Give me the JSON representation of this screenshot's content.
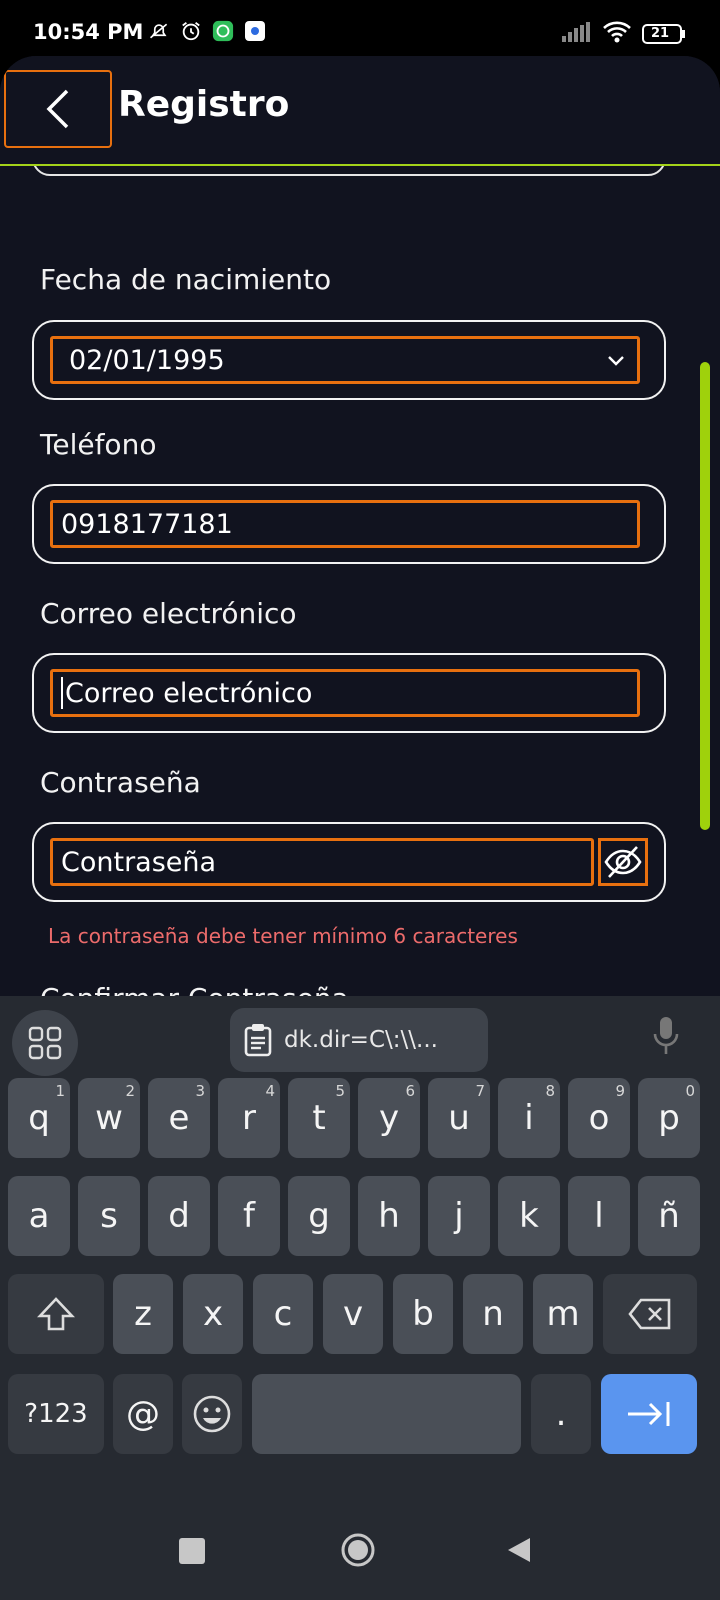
{
  "status_bar": {
    "time": "10:54 PM",
    "left_icons": [
      "mute-icon",
      "alarm-icon",
      "whatsapp-icon",
      "app-icon"
    ],
    "right_icons": [
      "signal-icon",
      "wifi-icon",
      "battery-icon"
    ],
    "battery": "21"
  },
  "header": {
    "title": "Registro"
  },
  "form": {
    "birthdate": {
      "label": "Fecha de nacimiento",
      "value": "02/01/1995"
    },
    "phone": {
      "label": "Teléfono",
      "value": "0918177181"
    },
    "email": {
      "label": "Correo electrónico",
      "placeholder": "Correo electrónico"
    },
    "password": {
      "label": "Contraseña",
      "placeholder": "Contraseña",
      "error": "La contraseña debe tener mínimo 6 caracteres"
    },
    "confirm_password": {
      "label": "Confirmar Contraseña"
    }
  },
  "keyboard": {
    "clipboard_text": "dk.dir=C\\:\\\\...",
    "row1": [
      {
        "k": "q",
        "h": "1"
      },
      {
        "k": "w",
        "h": "2"
      },
      {
        "k": "e",
        "h": "3"
      },
      {
        "k": "r",
        "h": "4"
      },
      {
        "k": "t",
        "h": "5"
      },
      {
        "k": "y",
        "h": "6"
      },
      {
        "k": "u",
        "h": "7"
      },
      {
        "k": "i",
        "h": "8"
      },
      {
        "k": "o",
        "h": "9"
      },
      {
        "k": "p",
        "h": "0"
      }
    ],
    "row2": [
      "a",
      "s",
      "d",
      "f",
      "g",
      "h",
      "j",
      "k",
      "l",
      "ñ"
    ],
    "row3": [
      "z",
      "x",
      "c",
      "v",
      "b",
      "n",
      "m"
    ],
    "symbols_label": "?123",
    "at_label": "@",
    "period_label": "."
  }
}
